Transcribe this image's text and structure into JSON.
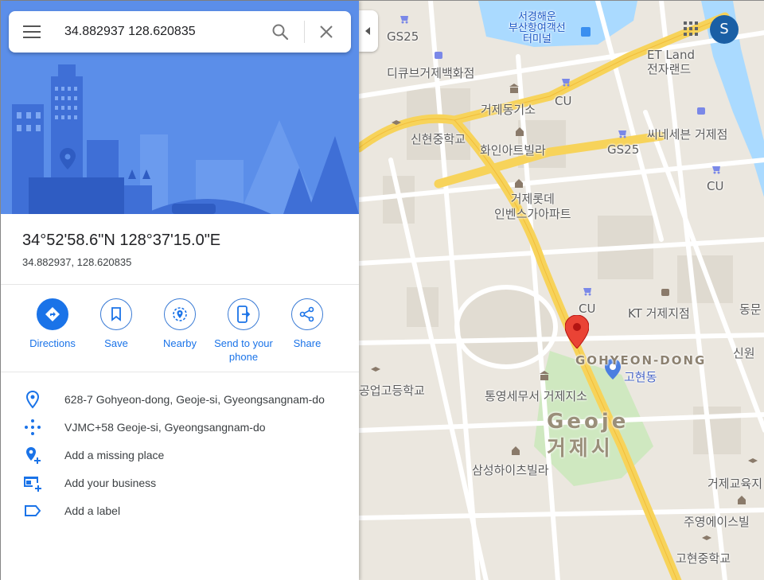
{
  "search": {
    "query": "34.882937 128.620835"
  },
  "place": {
    "title": "34°52'58.6\"N 128°37'15.0\"E",
    "decimal": "34.882937, 128.620835"
  },
  "actions": [
    {
      "label": "Directions",
      "icon": "directions-icon"
    },
    {
      "label": "Save",
      "icon": "bookmark-icon"
    },
    {
      "label": "Nearby",
      "icon": "nearby-icon"
    },
    {
      "label": "Send to your phone",
      "icon": "send-to-phone-icon"
    },
    {
      "label": "Share",
      "icon": "share-icon"
    }
  ],
  "details": [
    {
      "text": "628-7 Gohyeon-dong, Geoje-si, Gyeongsangnam-do",
      "icon": "location-pin-icon"
    },
    {
      "text": "VJMC+58 Geoje-si, Gyeongsangnam-do",
      "icon": "plus-code-icon"
    },
    {
      "text": "Add a missing place",
      "icon": "add-place-icon"
    },
    {
      "text": "Add your business",
      "icon": "add-business-icon"
    },
    {
      "text": "Add a label",
      "icon": "label-icon"
    }
  ],
  "account": {
    "initial": "S",
    "color": "#1a5fa5"
  },
  "map_labels": {
    "terminal": "서경해운\n부산항여객선\n터미널",
    "gs25_a": "GS25",
    "gs25_b": "GS25",
    "dept_store": "디큐브거제백화점",
    "etland": "ET Land\n전자랜드",
    "cu_a": "CU",
    "cu_b": "CU",
    "cu_c": "CU",
    "geoje_gisu": "거제동기소",
    "sinhyeon_ms": "신현중학교",
    "hwain_villa": "화인아트빌라",
    "ssine": "씨네세븐 거제점",
    "lotte": "거제롯데\n인벤스가아파트",
    "kt": "KT 거제지점",
    "gohyeon_dong": "GOHYEON-DONG",
    "gohyeon": "고현동",
    "ind_hs": "공업고등학교",
    "tax_office": "통영세무서 거제지소",
    "geoje_en": "Geoje",
    "geoje_ko": "거제시",
    "samsung_villa": "삼성하이츠빌라",
    "edu_office": "거제교육지",
    "jooyoung": "주영에이스빌",
    "gohyeon_ms": "고현중학교",
    "sinwon": "신원",
    "dong": "동문"
  },
  "colors": {
    "accent": "#1a73e8",
    "marker": "#ea4335",
    "hero": "#5a8de8"
  }
}
